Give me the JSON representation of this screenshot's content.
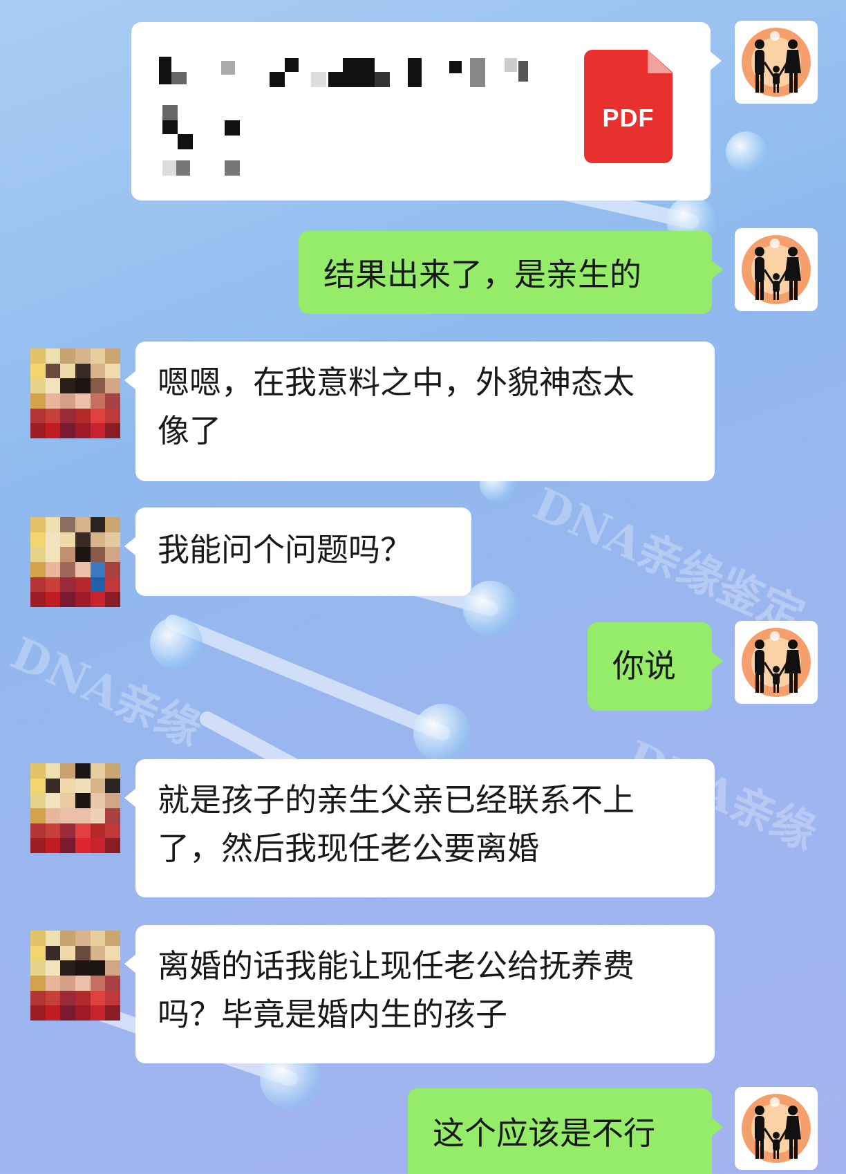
{
  "chat": {
    "file_message": {
      "file_type_label": "PDF"
    },
    "messages": [
      {
        "text": "结果出来了，是亲生的"
      },
      {
        "text": "嗯嗯，在我意料之中，外貌神态太像了"
      },
      {
        "text": "我能问个问题吗？"
      },
      {
        "text": "你说"
      },
      {
        "text": "就是孩子的亲生父亲已经联系不上了，然后我现任老公要离婚"
      },
      {
        "text": "离婚的话我能让现任老公给抚养费吗？毕竟是婚内生的孩子"
      },
      {
        "text": "这个应该是不行"
      }
    ]
  },
  "colors": {
    "self_bubble": "#95ec69",
    "other_bubble": "#ffffff",
    "pdf_red": "#e8312f"
  },
  "icons": [
    "family-silhouette-avatar",
    "pixelated-avatar",
    "pdf-file-icon"
  ]
}
